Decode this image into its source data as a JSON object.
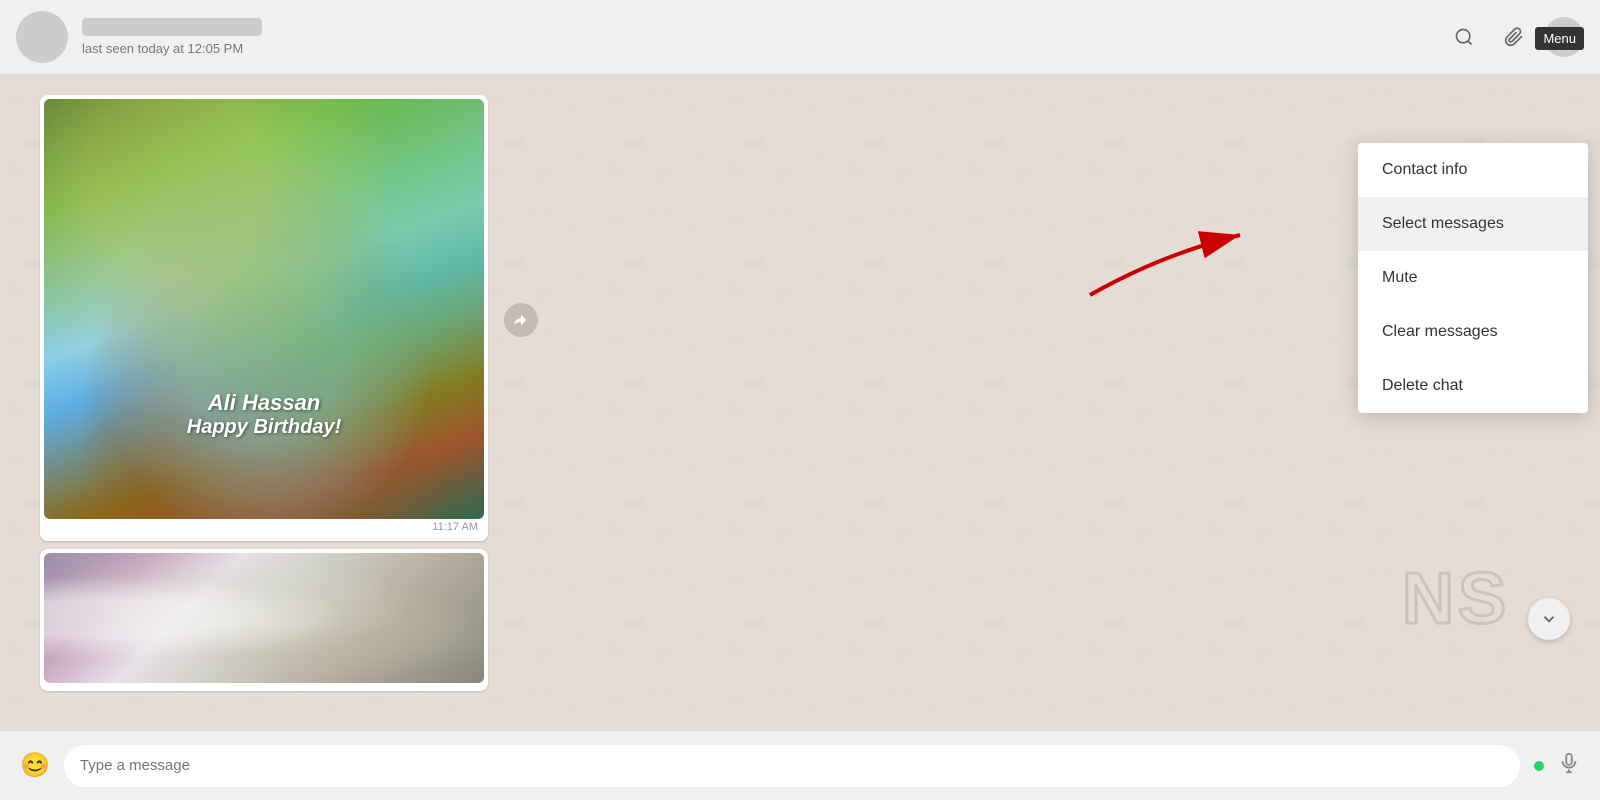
{
  "header": {
    "contact_status": "last seen today at 12:05 PM",
    "search_icon": "🔍",
    "attachment_icon": "📎",
    "menu_tooltip": "Menu"
  },
  "context_menu": {
    "items": [
      {
        "label": "Contact info",
        "id": "contact-info"
      },
      {
        "label": "Select messages",
        "id": "select-messages"
      },
      {
        "label": "Mute",
        "id": "mute"
      },
      {
        "label": "Clear messages",
        "id": "clear-messages"
      },
      {
        "label": "Delete chat",
        "id": "delete-chat"
      }
    ]
  },
  "messages": [
    {
      "type": "image",
      "time": "11:17 AM",
      "caption": ""
    },
    {
      "type": "image",
      "time": "",
      "caption": ""
    }
  ],
  "cake_lines": [
    "Ali Hassan",
    "Happy Birthday!"
  ],
  "input_bar": {
    "placeholder": "Type a message"
  },
  "watermark": "NS"
}
